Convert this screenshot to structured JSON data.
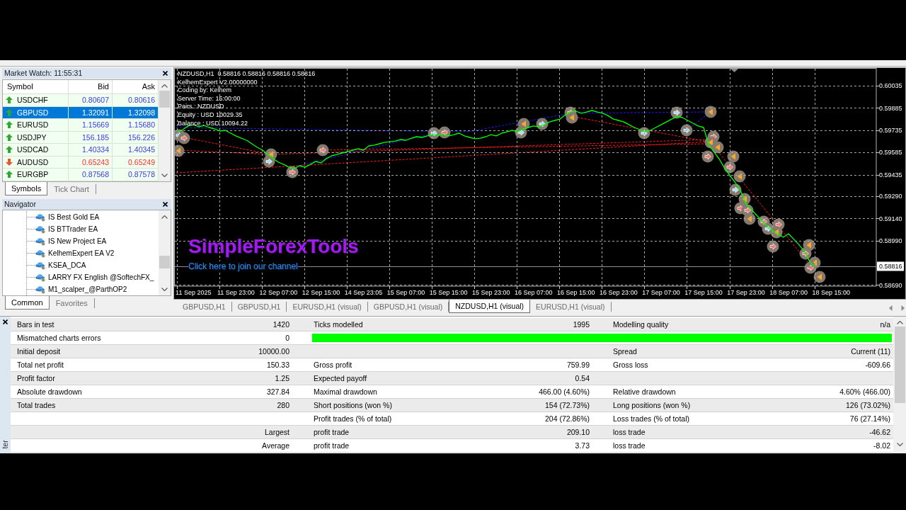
{
  "market_watch": {
    "title": "Market Watch: 11:55:31",
    "columns": [
      "Symbol",
      "Bid",
      "Ask"
    ],
    "rows": [
      {
        "symbol": "USDCHF",
        "bid": "0.80607",
        "ask": "0.80616",
        "rising": true,
        "selected": false
      },
      {
        "symbol": "GBPUSD",
        "bid": "1.32091",
        "ask": "1.32098",
        "rising": true,
        "selected": true
      },
      {
        "symbol": "EURUSD",
        "bid": "1.15669",
        "ask": "1.15680",
        "rising": true,
        "selected": false
      },
      {
        "symbol": "USDJPY",
        "bid": "156.185",
        "ask": "156.226",
        "rising": true,
        "selected": false
      },
      {
        "symbol": "USDCAD",
        "bid": "1.40334",
        "ask": "1.40345",
        "rising": true,
        "selected": false
      },
      {
        "symbol": "AUDUSD",
        "bid": "0.65243",
        "ask": "0.65249",
        "rising": false,
        "selected": false
      },
      {
        "symbol": "EURGBP",
        "bid": "0.87568",
        "ask": "0.87578",
        "rising": true,
        "selected": false
      }
    ],
    "tabs": [
      {
        "label": "Symbols",
        "selected": true
      },
      {
        "label": "Tick Chart",
        "selected": false
      }
    ]
  },
  "navigator": {
    "title": "Navigator",
    "items": [
      "IS Best Gold EA",
      "IS BTTrader EA",
      "IS New Project EA",
      "KelhemExpert EA V2",
      "KSEA_DCA",
      "LARRY FX English @SoftechFX_",
      "M1_scalper_@ParthOP2"
    ],
    "tabs": [
      {
        "label": "Common",
        "selected": true
      },
      {
        "label": "Favorites",
        "selected": false
      }
    ]
  },
  "chart": {
    "header": "NZDUSD,H1  0.58816 0.58816 0.58816 0.58816",
    "info_lines": [
      "KelhemExpert V2.00000000",
      "Coding by: Kelhem",
      "Server Time: 15:00:00",
      "Pairs : NZDUSD",
      "Equity : USD 10029.35",
      "Balance : USD 10094.22"
    ],
    "banner": "SimpleForexTools",
    "link": "Click here to join our channel",
    "chart_data": {
      "type": "line",
      "categories": [
        null,
        null,
        null,
        "11 Sep 2025",
        null,
        null,
        null,
        null,
        null,
        null,
        null,
        "11 Sep 23:00",
        null,
        null,
        null,
        null,
        null,
        null,
        null,
        "12 Sep 07:00",
        null,
        null,
        null,
        null,
        null,
        null,
        null,
        "12 Sep 15:00",
        null,
        null,
        null,
        null,
        null,
        null,
        null,
        "14 Sep 23:05",
        null,
        null,
        null,
        null,
        null,
        null,
        null,
        "15 Sep 07:00",
        null,
        null,
        null,
        null,
        null,
        null,
        null,
        "15 Sep 15:00",
        null,
        null,
        null,
        null,
        null,
        null,
        null,
        "15 Sep 23:00",
        null,
        null,
        null,
        null,
        null,
        null,
        null,
        "16 Sep 07:00",
        null,
        null,
        null,
        null,
        null,
        null,
        null,
        "16 Sep 15:00",
        null,
        null,
        null,
        null,
        null,
        null,
        null,
        "16 Sep 23:00",
        null,
        null,
        null,
        null,
        null,
        null,
        null,
        "17 Sep 07:00",
        null,
        null,
        null,
        null,
        null,
        null,
        null,
        "17 Sep 15:00",
        null,
        null,
        null,
        null,
        null,
        null,
        null,
        "17 Sep 23:00",
        null,
        null,
        null,
        null,
        null,
        null,
        null,
        "18 Sep 07:00",
        null,
        null,
        null,
        null,
        null,
        null,
        null,
        "18 Sep 15:00",
        null,
        null,
        null,
        null,
        null,
        null,
        null,
        null
      ],
      "ylim": [
        0.58682,
        0.6015
      ],
      "yticks": [
        {
          "value": 0.60035,
          "label": "0.60035"
        },
        {
          "value": 0.59885,
          "label": "0.59885"
        },
        {
          "value": 0.59735,
          "label": "0.59735"
        },
        {
          "value": 0.59585,
          "label": "0.59585"
        },
        {
          "value": 0.59435,
          "label": "0.59435"
        },
        {
          "value": 0.5929,
          "label": "0.59290"
        },
        {
          "value": 0.5914,
          "label": "0.59140"
        },
        {
          "value": 0.5899,
          "label": "0.58990"
        },
        {
          "value": 0.5869,
          "label": "0.58690"
        }
      ],
      "grid": true,
      "series": [
        {
          "color": "#00ff00",
          "values": [
            0.59724,
            0.59739,
            0.59763,
            0.59772,
            0.59758,
            0.59767,
            0.59753,
            0.59743,
            0.59729,
            0.59734,
            0.59715,
            0.59696,
            0.59681,
            0.59667,
            0.59643,
            0.59619,
            0.596,
            0.59571,
            0.59543,
            0.59519,
            0.59504,
            0.59485,
            0.59476,
            0.59495,
            0.59485,
            0.59504,
            0.59524,
            0.59514,
            0.59543,
            0.59562,
            0.59571,
            0.59581,
            0.5959,
            0.596,
            0.5961,
            0.596,
            0.59629,
            0.59634,
            0.59643,
            0.59653,
            0.59657,
            0.59662,
            0.59672,
            0.59667,
            0.59681,
            0.59691,
            0.59686,
            0.59696,
            0.59705,
            0.597,
            0.5971,
            0.59696,
            0.59705,
            0.59715,
            0.59696,
            0.59686,
            0.59677,
            0.59681,
            0.59691,
            0.59705,
            0.59696,
            0.59715,
            0.59724,
            0.59734,
            0.59724,
            0.59743,
            0.59753,
            0.59763,
            0.59758,
            0.59772,
            0.59791,
            0.59801,
            0.5981,
            0.59839,
            0.59858,
            0.59863,
            0.59849,
            0.59858,
            0.59868,
            0.59858,
            0.59849,
            0.59834,
            0.5981,
            0.59801,
            0.59791,
            0.59772,
            0.59753,
            0.59739,
            0.59724,
            0.59734,
            0.59753,
            0.59772,
            0.59791,
            0.5981,
            0.59829,
            0.5982,
            0.59801,
            0.59782,
            0.59763,
            0.59753,
            0.59634,
            0.59586,
            0.59538,
            0.59476,
            0.59428,
            0.5938,
            0.59323,
            0.59237,
            0.59199,
            0.5916,
            0.59122,
            0.59084,
            0.59055,
            0.59036,
            0.59012,
            0.59036,
            0.58998,
            0.5896,
            0.58917,
            0.58845,
            0.58816,
            null,
            null,
            null,
            null,
            null,
            null,
            null,
            null,
            null,
            null,
            null
          ]
        }
      ],
      "ref_lines": [
        {
          "axis": "y",
          "value": 0.58816,
          "label": "0.58816"
        }
      ]
    }
  },
  "chart_tabs": [
    {
      "label": "GBPUSD,H1",
      "selected": false
    },
    {
      "label": "GBPUSD,H1",
      "selected": false
    },
    {
      "label": "EURUSD,H1 (visual)",
      "selected": false
    },
    {
      "label": "GBPUSD,H1 (visual)",
      "selected": false
    },
    {
      "label": "NZDUSD,H1 (visual)",
      "selected": true
    },
    {
      "label": "EURUSD,H1 (visual)",
      "selected": false
    }
  ],
  "report": {
    "side_label": "ter",
    "rows": [
      {
        "left": {
          "label": "Bars in test",
          "value": "1420"
        },
        "middle": {
          "label": "Ticks modelled",
          "value": "1995"
        },
        "right": {
          "label": "Modelling quality",
          "value": "n/a"
        }
      },
      {
        "left": {
          "label": "Mismatched charts errors",
          "value": "0"
        },
        "quality_bar": {
          "level": 1
        }
      },
      {
        "left": {
          "label": "Initial deposit",
          "value": "10000.00"
        },
        "right": {
          "label": "Spread",
          "value": "Current (11)"
        }
      },
      {
        "left": {
          "label": "Total net profit",
          "value": "150.33"
        },
        "middle": {
          "label": "Gross profit",
          "value": "759.99"
        },
        "right": {
          "label": "Gross loss",
          "value": "-609.66"
        }
      },
      {
        "left": {
          "label": "Profit factor",
          "value": "1.25"
        },
        "middle": {
          "label": "Expected payoff",
          "value": "0.54"
        }
      },
      {
        "left": {
          "label": "Absolute drawdown",
          "value": "327.84"
        },
        "middle": {
          "label": "Maximal drawdown",
          "value": "466.00 (4.60%)"
        },
        "right": {
          "label": "Relative drawdown",
          "value": "4.60% (466.00)"
        }
      },
      {
        "left": {
          "label": "Total trades",
          "value": "280"
        },
        "middle": {
          "label": "Short positions (won %)",
          "value": "154 (72.73%)"
        },
        "right": {
          "label": "Long positions (won %)",
          "value": "126 (73.02%)"
        }
      },
      {
        "middle": {
          "label": "Profit trades (% of total)",
          "value": "204 (72.86%)"
        },
        "right": {
          "label": "Loss trades (% of total)",
          "value": "76 (27.14%)"
        }
      },
      {
        "left": {
          "value": "Largest"
        },
        "middle": {
          "label": "profit trade",
          "value": "209.10"
        },
        "right": {
          "label": "loss trade",
          "value": "-46.62"
        }
      },
      {
        "left": {
          "value": "Average"
        },
        "middle": {
          "label": "profit trade",
          "value": "3.73"
        },
        "right": {
          "label": "loss trade",
          "value": "-8.02"
        }
      }
    ]
  }
}
